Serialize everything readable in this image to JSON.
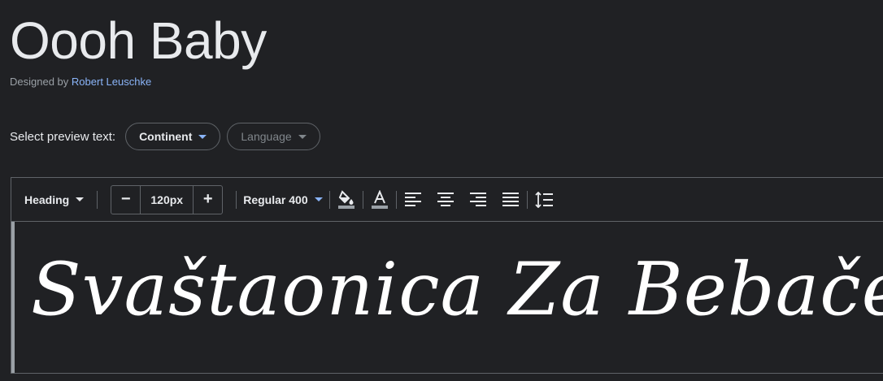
{
  "font": {
    "name": "Oooh Baby",
    "designed_by_label": "Designed by",
    "designer": "Robert Leuschke"
  },
  "preview_select": {
    "label": "Select preview text:",
    "continent": "Continent",
    "language": "Language"
  },
  "toolbar": {
    "style": "Heading",
    "decrease": "−",
    "size": "120px",
    "increase": "+",
    "weight": "Regular 400",
    "icons": [
      "fill-color-icon",
      "text-color-icon",
      "align-left-icon",
      "align-center-icon",
      "align-right-icon",
      "align-justify-icon",
      "line-height-icon"
    ]
  },
  "preview": {
    "text": "Svaštaonica Za Bebače"
  },
  "colors": {
    "background": "#202124",
    "text": "#e8eaed",
    "muted": "#9aa0a6",
    "accent": "#8ab4f8",
    "border": "#5f6368"
  }
}
